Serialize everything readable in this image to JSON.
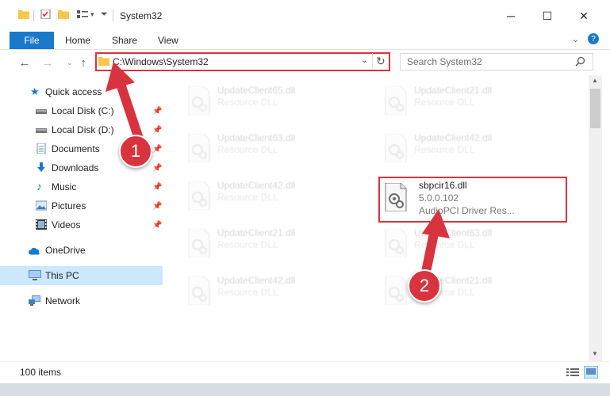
{
  "window": {
    "title": "System32",
    "minimize_glyph": "─",
    "maximize_glyph": "☐",
    "close_glyph": "✕"
  },
  "ribbon": {
    "tabs": [
      "File",
      "Home",
      "Share",
      "View"
    ]
  },
  "nav": {
    "address": "C:\\Windows\\System32",
    "search_placeholder": "Search System32"
  },
  "sidebar": {
    "quick_access": "Quick access",
    "items": [
      {
        "label": "Local Disk (C:)",
        "icon": "drive-icon"
      },
      {
        "label": "Local Disk (D:)",
        "icon": "drive-icon"
      },
      {
        "label": "Documents",
        "icon": "documents-icon"
      },
      {
        "label": "Downloads",
        "icon": "downloads-icon"
      },
      {
        "label": "Music",
        "icon": "music-icon"
      },
      {
        "label": "Pictures",
        "icon": "pictures-icon"
      },
      {
        "label": "Videos",
        "icon": "videos-icon"
      }
    ],
    "onedrive": "OneDrive",
    "this_pc": "This PC",
    "network": "Network"
  },
  "files": {
    "left_column": [
      {
        "name": "UpdateClient65.dll",
        "type": "Resource DLL"
      },
      {
        "name": "UpdateClient63.dll",
        "type": "Resource DLL"
      },
      {
        "name": "UpdateClient42.dll",
        "type": "Resource DLL"
      },
      {
        "name": "UpdateClient21.dll",
        "type": "Resource DLL"
      },
      {
        "name": "UpdateClient42.dll",
        "type": "Resource DLL"
      }
    ],
    "right_column": [
      {
        "name": "UpdateClient21.dll",
        "type": "Resource DLL"
      },
      {
        "name": "UpdateClient42.dll",
        "type": "Resource DLL"
      },
      {
        "name": "UpdateClient63.dll",
        "type": "Resource DLL"
      },
      {
        "name": "UpdateClient21.dll",
        "type": "Resource DLL"
      }
    ],
    "highlighted": {
      "name": "sbpcir16.dll",
      "version": "5.0.0.102",
      "description": "AudioPCI Driver Res..."
    }
  },
  "status": {
    "item_count": "100 items"
  },
  "annotations": {
    "badge_1": "1",
    "badge_2": "2"
  },
  "colors": {
    "accent": "#1979ca",
    "highlight_red": "#d8343f",
    "selection": "#cce8ff"
  }
}
